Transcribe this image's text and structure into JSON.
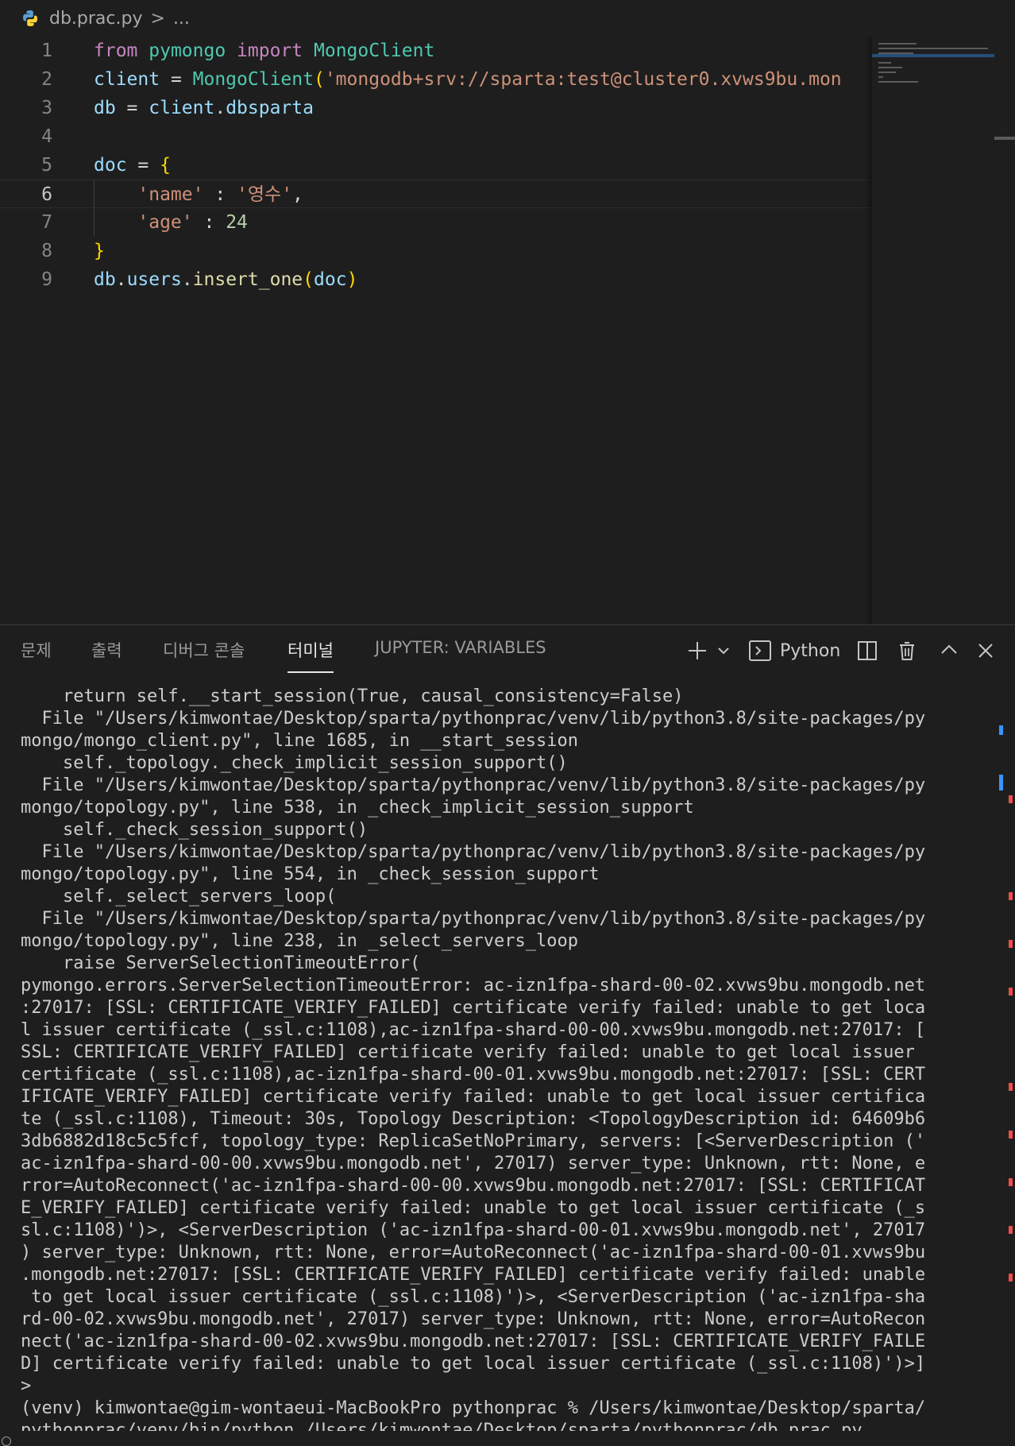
{
  "breadcrumb": {
    "file": "db.prac.py",
    "separator": ">",
    "more": "..."
  },
  "editor": {
    "lines": [
      {
        "n": "1",
        "tokens": [
          [
            "kw",
            "from"
          ],
          [
            "op",
            " "
          ],
          [
            "mod",
            "pymongo"
          ],
          [
            "op",
            " "
          ],
          [
            "kw",
            "import"
          ],
          [
            "op",
            " "
          ],
          [
            "cls",
            "MongoClient"
          ]
        ]
      },
      {
        "n": "2",
        "tokens": [
          [
            "var",
            "client"
          ],
          [
            "op",
            " = "
          ],
          [
            "cls",
            "MongoClient"
          ],
          [
            "br1",
            "("
          ],
          [
            "str",
            "'mongodb+srv://sparta:test@cluster0.xvws9bu.mon"
          ]
        ]
      },
      {
        "n": "3",
        "tokens": [
          [
            "var",
            "db"
          ],
          [
            "op",
            " = "
          ],
          [
            "var",
            "client"
          ],
          [
            "op",
            "."
          ],
          [
            "var",
            "dbsparta"
          ]
        ]
      },
      {
        "n": "4",
        "tokens": []
      },
      {
        "n": "5",
        "tokens": [
          [
            "var",
            "doc"
          ],
          [
            "op",
            " = "
          ],
          [
            "br1",
            "{"
          ]
        ]
      },
      {
        "n": "6",
        "tokens": [
          [
            "op",
            "    "
          ],
          [
            "str",
            "'name'"
          ],
          [
            "op",
            " : "
          ],
          [
            "str",
            "'영수'"
          ],
          [
            "op",
            ","
          ]
        ]
      },
      {
        "n": "7",
        "tokens": [
          [
            "op",
            "    "
          ],
          [
            "str",
            "'age'"
          ],
          [
            "op",
            " : "
          ],
          [
            "num",
            "24"
          ]
        ]
      },
      {
        "n": "8",
        "tokens": [
          [
            "br1",
            "}"
          ]
        ]
      },
      {
        "n": "9",
        "tokens": [
          [
            "var",
            "db"
          ],
          [
            "op",
            "."
          ],
          [
            "var",
            "users"
          ],
          [
            "op",
            "."
          ],
          [
            "fn",
            "insert_one"
          ],
          [
            "br1",
            "("
          ],
          [
            "var",
            "doc"
          ],
          [
            "br1",
            ")"
          ]
        ]
      }
    ],
    "active_line": "6"
  },
  "panel": {
    "tabs": [
      "문제",
      "출력",
      "디버그 콘솔",
      "터미널",
      "JUPYTER: VARIABLES"
    ],
    "active_tab": "터미널",
    "terminal_name": "Python"
  },
  "terminal": {
    "lines": [
      "    return self.__start_session(True, causal_consistency=False)",
      "  File \"/Users/kimwontae/Desktop/sparta/pythonprac/venv/lib/python3.8/site-packages/py",
      "mongo/mongo_client.py\", line 1685, in __start_session",
      "    self._topology._check_implicit_session_support()",
      "  File \"/Users/kimwontae/Desktop/sparta/pythonprac/venv/lib/python3.8/site-packages/py",
      "mongo/topology.py\", line 538, in _check_implicit_session_support",
      "    self._check_session_support()",
      "  File \"/Users/kimwontae/Desktop/sparta/pythonprac/venv/lib/python3.8/site-packages/py",
      "mongo/topology.py\", line 554, in _check_session_support",
      "    self._select_servers_loop(",
      "  File \"/Users/kimwontae/Desktop/sparta/pythonprac/venv/lib/python3.8/site-packages/py",
      "mongo/topology.py\", line 238, in _select_servers_loop",
      "    raise ServerSelectionTimeoutError(",
      "pymongo.errors.ServerSelectionTimeoutError: ac-izn1fpa-shard-00-02.xvws9bu.mongodb.net",
      ":27017: [SSL: CERTIFICATE_VERIFY_FAILED] certificate verify failed: unable to get loca",
      "l issuer certificate (_ssl.c:1108),ac-izn1fpa-shard-00-00.xvws9bu.mongodb.net:27017: [",
      "SSL: CERTIFICATE_VERIFY_FAILED] certificate verify failed: unable to get local issuer ",
      "certificate (_ssl.c:1108),ac-izn1fpa-shard-00-01.xvws9bu.mongodb.net:27017: [SSL: CERT",
      "IFICATE_VERIFY_FAILED] certificate verify failed: unable to get local issuer certifica",
      "te (_ssl.c:1108), Timeout: 30s, Topology Description: <TopologyDescription id: 64609b6",
      "3db6882d18c5c5fcf, topology_type: ReplicaSetNoPrimary, servers: [<ServerDescription ('",
      "ac-izn1fpa-shard-00-00.xvws9bu.mongodb.net', 27017) server_type: Unknown, rtt: None, e",
      "rror=AutoReconnect('ac-izn1fpa-shard-00-00.xvws9bu.mongodb.net:27017: [SSL: CERTIFICAT",
      "E_VERIFY_FAILED] certificate verify failed: unable to get local issuer certificate (_s",
      "sl.c:1108)')>, <ServerDescription ('ac-izn1fpa-shard-00-01.xvws9bu.mongodb.net', 27017",
      ") server_type: Unknown, rtt: None, error=AutoReconnect('ac-izn1fpa-shard-00-01.xvws9bu",
      ".mongodb.net:27017: [SSL: CERTIFICATE_VERIFY_FAILED] certificate verify failed: unable",
      " to get local issuer certificate (_ssl.c:1108)')>, <ServerDescription ('ac-izn1fpa-sha",
      "rd-00-02.xvws9bu.mongodb.net', 27017) server_type: Unknown, rtt: None, error=AutoRecon",
      "nect('ac-izn1fpa-shard-00-02.xvws9bu.mongodb.net:27017: [SSL: CERTIFICATE_VERIFY_FAILE",
      "D] certificate verify failed: unable to get local issuer certificate (_ssl.c:1108)')>]",
      ">",
      "(venv) kimwontae@gim-wontaeui-MacBookPro pythonprac % /Users/kimwontae/Desktop/sparta/",
      "pythonprac/venv/bin/python /Users/kimwontae/Desktop/sparta/pythonprac/db.prac.py"
    ]
  },
  "colors": {
    "background": "#1e1e1e",
    "keyword": "#c586c0",
    "class": "#4ec9b0",
    "variable": "#9cdcfe",
    "string": "#ce9178",
    "number": "#b5cea8",
    "function": "#dcdcaa",
    "bracket": "#ffd700"
  },
  "icons": [
    "python-file-icon",
    "plus-icon",
    "chevron-down-icon",
    "terminal-icon",
    "split-icon",
    "trash-icon",
    "chevron-up-icon",
    "close-icon"
  ]
}
